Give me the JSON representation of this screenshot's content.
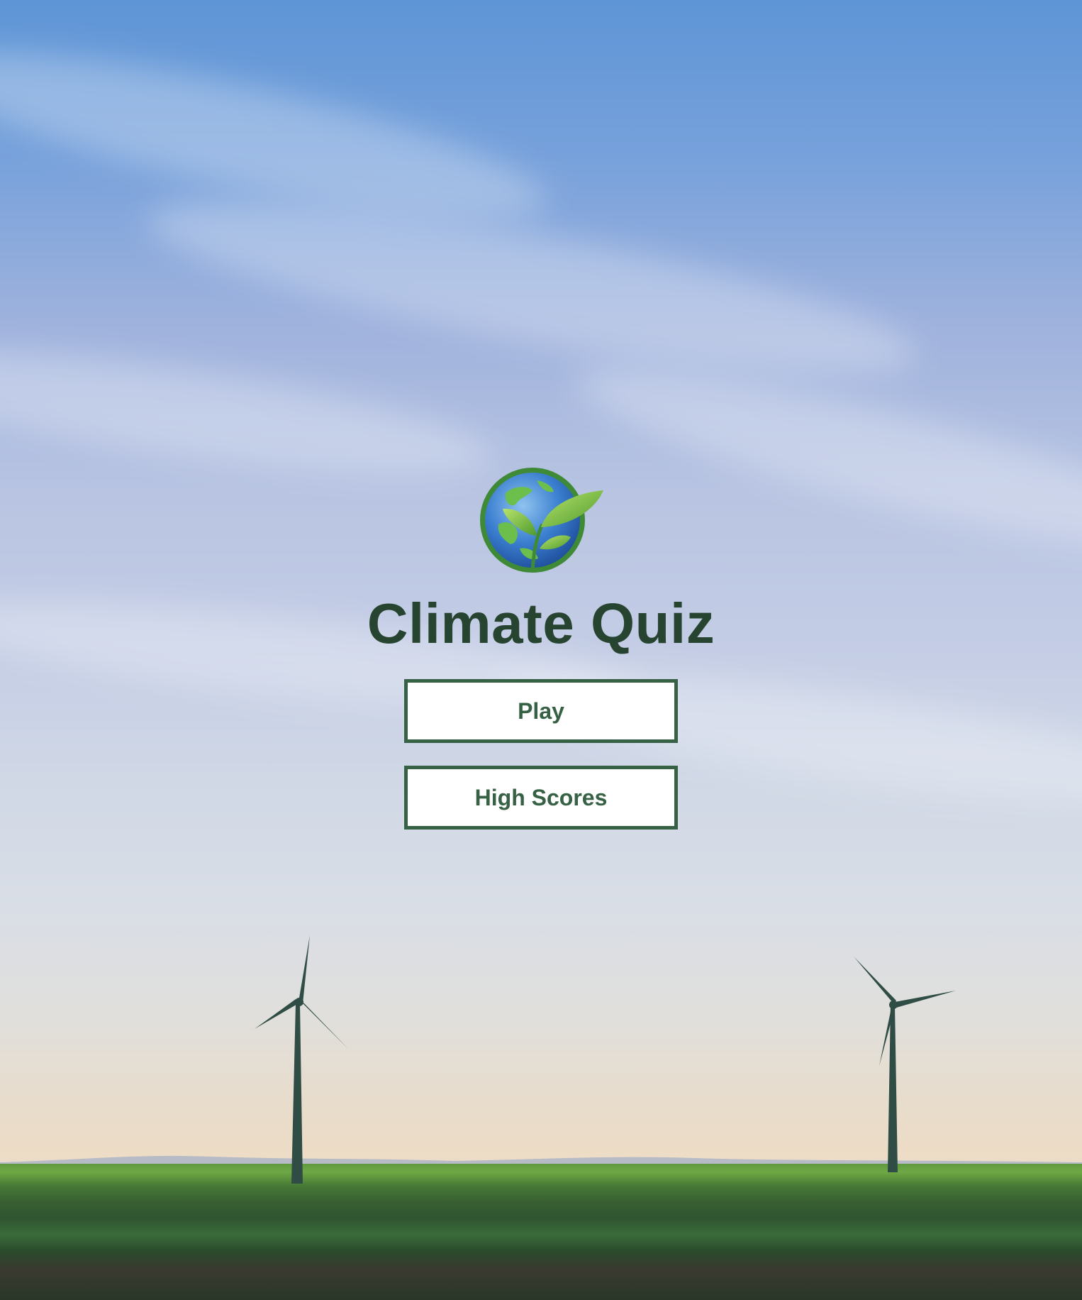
{
  "app": {
    "title": "Climate Quiz",
    "logo_icon": "globe-leaf-icon"
  },
  "menu": {
    "play_label": "Play",
    "high_scores_label": "High Scores"
  },
  "colors": {
    "accent": "#376145",
    "title": "#274430",
    "button_bg": "#ffffff"
  },
  "background": {
    "scene": "sky-with-wind-turbines"
  }
}
